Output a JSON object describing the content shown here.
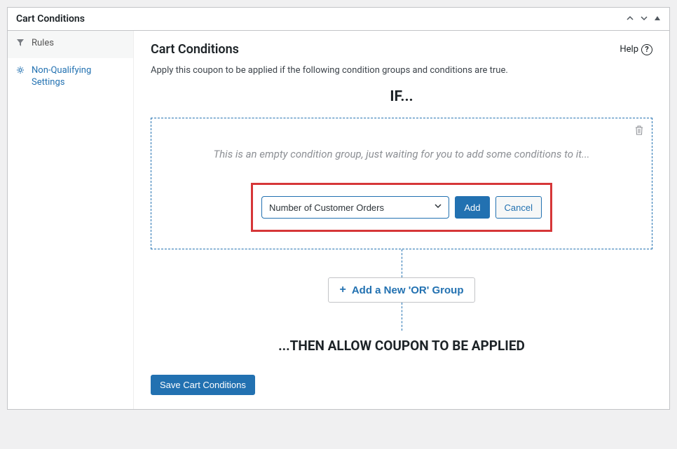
{
  "panel": {
    "title": "Cart Conditions"
  },
  "sidebar": {
    "items": [
      {
        "label": "Rules"
      },
      {
        "label": "Non-Qualifying Settings"
      }
    ]
  },
  "main": {
    "title": "Cart Conditions",
    "help_label": "Help",
    "description": "Apply this coupon to be applied if the following condition groups and conditions are true.",
    "if_label": "IF...",
    "then_label": "...THEN ALLOW COUPON TO BE APPLIED",
    "empty_group_msg": "This is an empty condition group, just waiting for you to add some conditions to it...",
    "select_value": "Number of Customer Orders",
    "add_label": "Add",
    "cancel_label": "Cancel",
    "add_group_label": "Add a New 'OR' Group",
    "save_label": "Save Cart Conditions"
  }
}
